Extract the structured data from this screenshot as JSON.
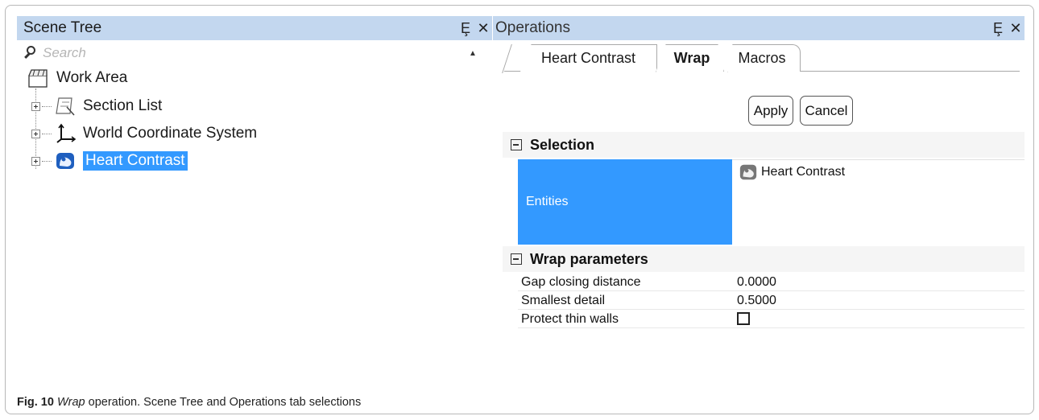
{
  "scene_tree": {
    "title": "Scene Tree",
    "pin_glyph": "Ȩ",
    "close_glyph": "✕",
    "search": {
      "placeholder": "Search"
    },
    "items": [
      {
        "label": "Work Area",
        "icon": "work-area-icon"
      },
      {
        "label": "Section List",
        "icon": "section-list-icon"
      },
      {
        "label": "World Coordinate System",
        "icon": "coordinate-axes-icon"
      },
      {
        "label": "Heart Contrast",
        "icon": "mask-object-icon",
        "selected": true
      }
    ]
  },
  "operations": {
    "title": "Operations",
    "tabs": [
      {
        "label": "Heart Contrast"
      },
      {
        "label": "Wrap",
        "active": true
      },
      {
        "label": "Macros"
      }
    ],
    "buttons": {
      "apply": "Apply",
      "cancel": "Cancel"
    },
    "sections": {
      "selection": {
        "title": "Selection",
        "entities_label": "Entities",
        "entities_value": "Heart Contrast"
      },
      "wrap_parameters": {
        "title": "Wrap parameters",
        "rows": [
          {
            "key": "Gap closing distance",
            "value": "0.0000"
          },
          {
            "key": "Smallest detail",
            "value": "0.5000"
          },
          {
            "key": "Protect thin walls",
            "value": "",
            "checkbox": false
          }
        ]
      }
    }
  },
  "caption": {
    "fig": "Fig. 10",
    "op": "Wrap",
    "text": "operation. Scene Tree and Operations tab selections"
  },
  "colors": {
    "header_bg": "#c3d7ef",
    "selection": "#3399ff"
  }
}
